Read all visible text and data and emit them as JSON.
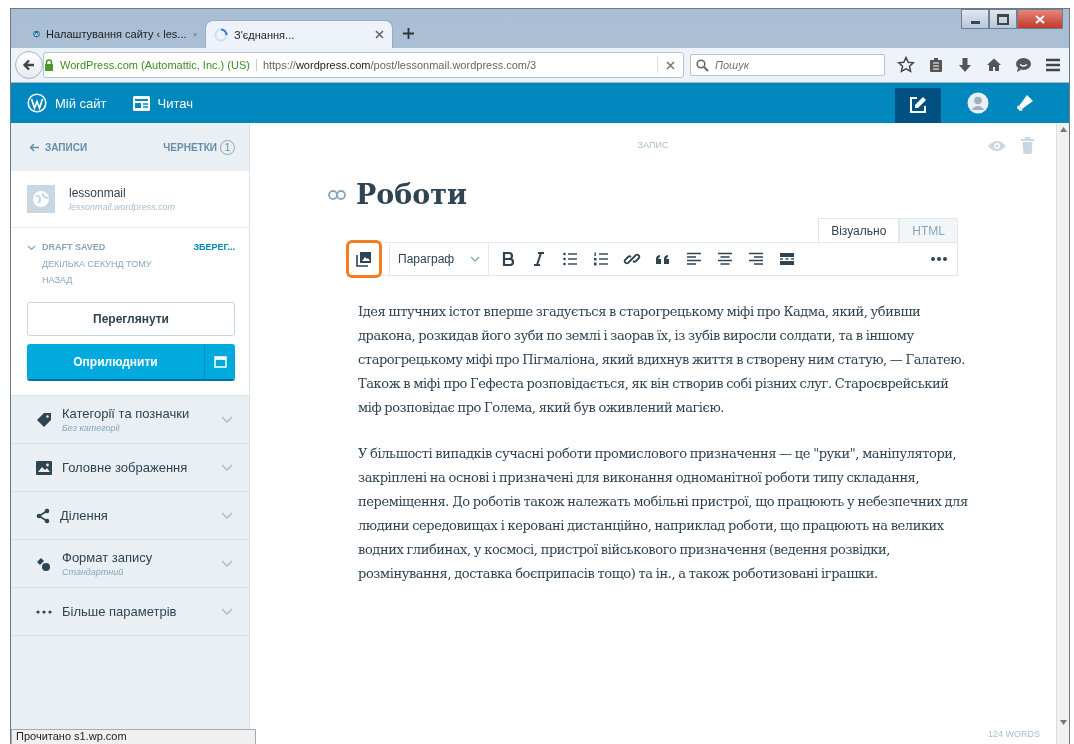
{
  "browser": {
    "tabs": [
      {
        "title": "Налаштування сайту ‹ les...",
        "kind": "site",
        "selected": false
      },
      {
        "title": "З'єднання...",
        "kind": "loading",
        "selected": true
      }
    ],
    "identity": "WordPress.com (Automattic, Inc.) (US)",
    "url": {
      "prefix": "https://",
      "host": "wordpress.com",
      "path": "/post/lessonmail.wordpress.com/3"
    },
    "search": {
      "placeholder": "Пошук"
    },
    "status": "Прочитано s1.wp.com"
  },
  "masterbar": {
    "items": [
      {
        "label": "Мій сайт",
        "kind": "logo"
      },
      {
        "label": "Читач",
        "kind": "reader"
      }
    ]
  },
  "sidebar": {
    "back": "ЗАПИСИ",
    "drafts": {
      "label": "ЧЕРНЕТКИ",
      "count": "1"
    },
    "site": {
      "name": "lessonmail",
      "address": "lessonmail.wordpress.com"
    },
    "draft": {
      "status": "DRAFT SAVED",
      "time": "ДЕКІЛЬКА СЕКУНД ТОМУ НАЗАД",
      "save": "ЗБЕРЕГ..."
    },
    "preview": "Переглянути",
    "publish": "Оприлюднити",
    "sections": [
      {
        "label": "Категорії та позначки",
        "subtitle": "Без категорії",
        "kind": "tag"
      },
      {
        "label": "Головне зображення",
        "kind": "image"
      },
      {
        "label": "Ділення",
        "kind": "share"
      },
      {
        "label": "Формат запису",
        "subtitle": "Стандартний",
        "kind": "format"
      },
      {
        "label": "Більше параметрів",
        "kind": "dots"
      }
    ]
  },
  "editor": {
    "heading": "ЗАПИС",
    "title": "Роботи",
    "modes": [
      {
        "label": "Візуально",
        "selected": true
      },
      {
        "label": "HTML",
        "selected": false
      }
    ],
    "format": "Параграф",
    "toolbar": [
      {
        "kind": "media",
        "highlighted": true
      },
      {
        "kind": "format",
        "highlighted": false
      },
      {
        "kind": "bold",
        "highlighted": false
      },
      {
        "kind": "italic",
        "highlighted": false
      },
      {
        "kind": "ul",
        "highlighted": false
      },
      {
        "kind": "ol",
        "highlighted": false
      },
      {
        "kind": "link",
        "highlighted": false
      },
      {
        "kind": "quote",
        "highlighted": false
      },
      {
        "kind": "left",
        "highlighted": false
      },
      {
        "kind": "center",
        "highlighted": false
      },
      {
        "kind": "right",
        "highlighted": false
      },
      {
        "kind": "more",
        "highlighted": false
      },
      {
        "kind": "dots",
        "highlighted": false
      }
    ],
    "paragraphs": [
      "Ідея штучних істот вперше згадується в старогрецькому міфі про Кадма, який, убивши дракона, розкидав його зуби по землі і заорав їх, із зубів виросли солдати, та в іншому старогрецькому міфі про Пігмаліона, який вдихнув життя в створену ним статую, — Галатею. Також в міфі про Гефеста розповідається, як він створив собі різних слуг. Староєврейський міф розповідає про Голема, який був оживлений магією.",
      "У більшості випадків сучасні роботи промислового призначення — це \"руки\", маніпулятори, закріплені на основі і призначені для виконання одноманітної роботи типу складання, переміщення. До роботів також належать мобільні пристрої, що працюють у небезпечних для людини середовищах і керовані дистанційно, наприклад роботи, що працюють на великих водних глибинах, у космосі, пристрої військового призначення (ведення розвідки, розмінування, доставка боєприпасів тощо) та ін., а також роботизовані іграшки."
    ],
    "words": "124 WORDS"
  }
}
